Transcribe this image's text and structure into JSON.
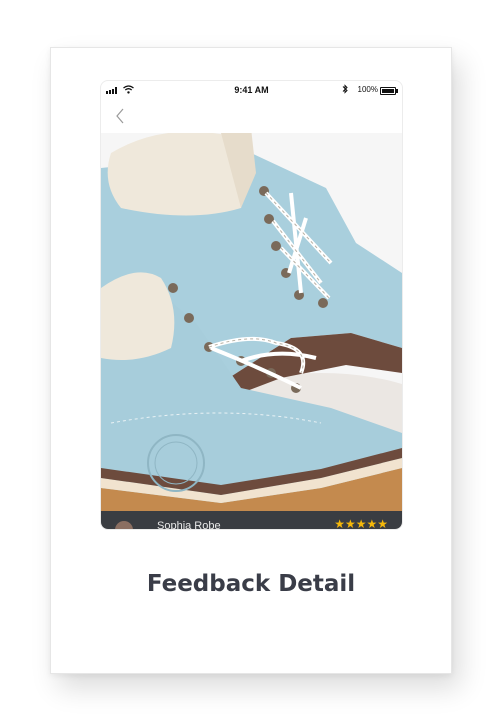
{
  "status_bar": {
    "time": "9:41 AM",
    "bluetooth_icon": "bluetooth-icon",
    "battery_percent": "100%",
    "signal_icon": "cellular-signal-icon",
    "wifi_icon": "wifi-icon",
    "battery_icon": "battery-icon"
  },
  "navbar": {
    "back_icon": "chevron-left-icon"
  },
  "review": {
    "reviewer_name": "Sophia Robe",
    "rating_stars": "★★★★★",
    "rating": 5,
    "max_rating": 5
  },
  "caption": {
    "title": "Feedback Detail"
  },
  "colors": {
    "boot": "#a9cfdd",
    "review_bar": "#3a3d42",
    "star": "#f5b80a",
    "title": "#3a3d48"
  }
}
